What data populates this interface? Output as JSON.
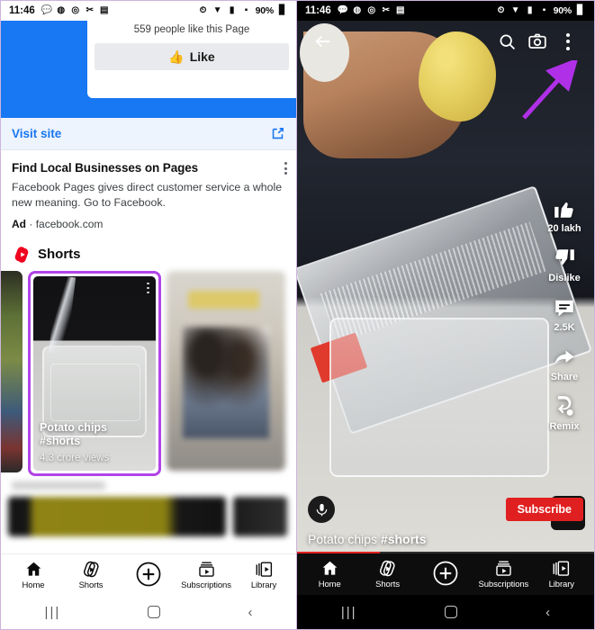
{
  "left": {
    "statusbar": {
      "time": "11:46",
      "app_icons": [
        "chat-icon",
        "whatsapp-icon",
        "instagram-icon",
        "snapchat-icon",
        "gallery-icon"
      ],
      "battery": "90%",
      "right_icons": [
        "alarm-icon",
        "wifi-icon",
        "signal-icon",
        "cellular-icon",
        "battery-icon"
      ]
    },
    "ad": {
      "likes_text": "559 people like this Page",
      "like_label": "Like",
      "visit_label": "Visit site",
      "title": "Find Local Businesses on Pages",
      "description": "Facebook Pages gives direct customer service a whole new meaning. Go to Facebook.",
      "badge": "Ad",
      "separator": "·",
      "domain": "facebook.com"
    },
    "shorts_shelf": {
      "title": "Shorts",
      "cards": [
        {
          "name": "",
          "views": "",
          "highlighted": false
        },
        {
          "name": "Potato chips\n#shorts",
          "title_line1": "Potato chips",
          "title_line2": "#shorts",
          "views": "4.3 crore views",
          "highlighted": true
        },
        {
          "name": "",
          "views": "",
          "highlighted": false
        }
      ]
    },
    "bottom_nav": {
      "items": [
        {
          "label": "Home",
          "icon": "home-icon"
        },
        {
          "label": "Shorts",
          "icon": "shorts-icon"
        },
        {
          "label": "",
          "icon": "plus-circle-icon"
        },
        {
          "label": "Subscriptions",
          "icon": "subscriptions-icon"
        },
        {
          "label": "Library",
          "icon": "library-icon"
        }
      ]
    },
    "system_nav": {
      "recent": "|||",
      "home": "",
      "back": "‹"
    }
  },
  "right": {
    "statusbar": {
      "time": "11:46",
      "battery": "90%"
    },
    "topbar": {
      "back_icon": "back-arrow-icon",
      "search_icon": "search-icon",
      "camera_icon": "camera-icon",
      "more_icon": "more-vertical-icon"
    },
    "annotation": {
      "arrow_color": "#b030e8",
      "points_to": "more-vertical-icon"
    },
    "rail": [
      {
        "label": "20 lakh",
        "icon": "thumbs-up-icon"
      },
      {
        "label": "Dislike",
        "icon": "thumbs-down-icon"
      },
      {
        "label": "2.5K",
        "icon": "comment-icon"
      },
      {
        "label": "Share",
        "icon": "share-icon"
      },
      {
        "label": "Remix",
        "icon": "remix-icon"
      }
    ],
    "meta": {
      "avatar_icon": "mic-avatar-icon",
      "subscribe_label": "Subscribe",
      "title_plain": "Potato chips ",
      "title_tag": "#shorts",
      "sound_icon": "mic-sound-icon"
    },
    "bottom_nav": {
      "items": [
        {
          "label": "Home",
          "icon": "home-icon"
        },
        {
          "label": "Shorts",
          "icon": "shorts-icon"
        },
        {
          "label": "",
          "icon": "plus-circle-icon"
        },
        {
          "label": "Subscriptions",
          "icon": "subscriptions-icon"
        },
        {
          "label": "Library",
          "icon": "library-icon"
        }
      ]
    },
    "system_nav": {
      "recent": "|||",
      "home": "",
      "back": "‹"
    },
    "colors": {
      "accent_red": "#e02020",
      "annotation_purple": "#b030e8"
    }
  }
}
